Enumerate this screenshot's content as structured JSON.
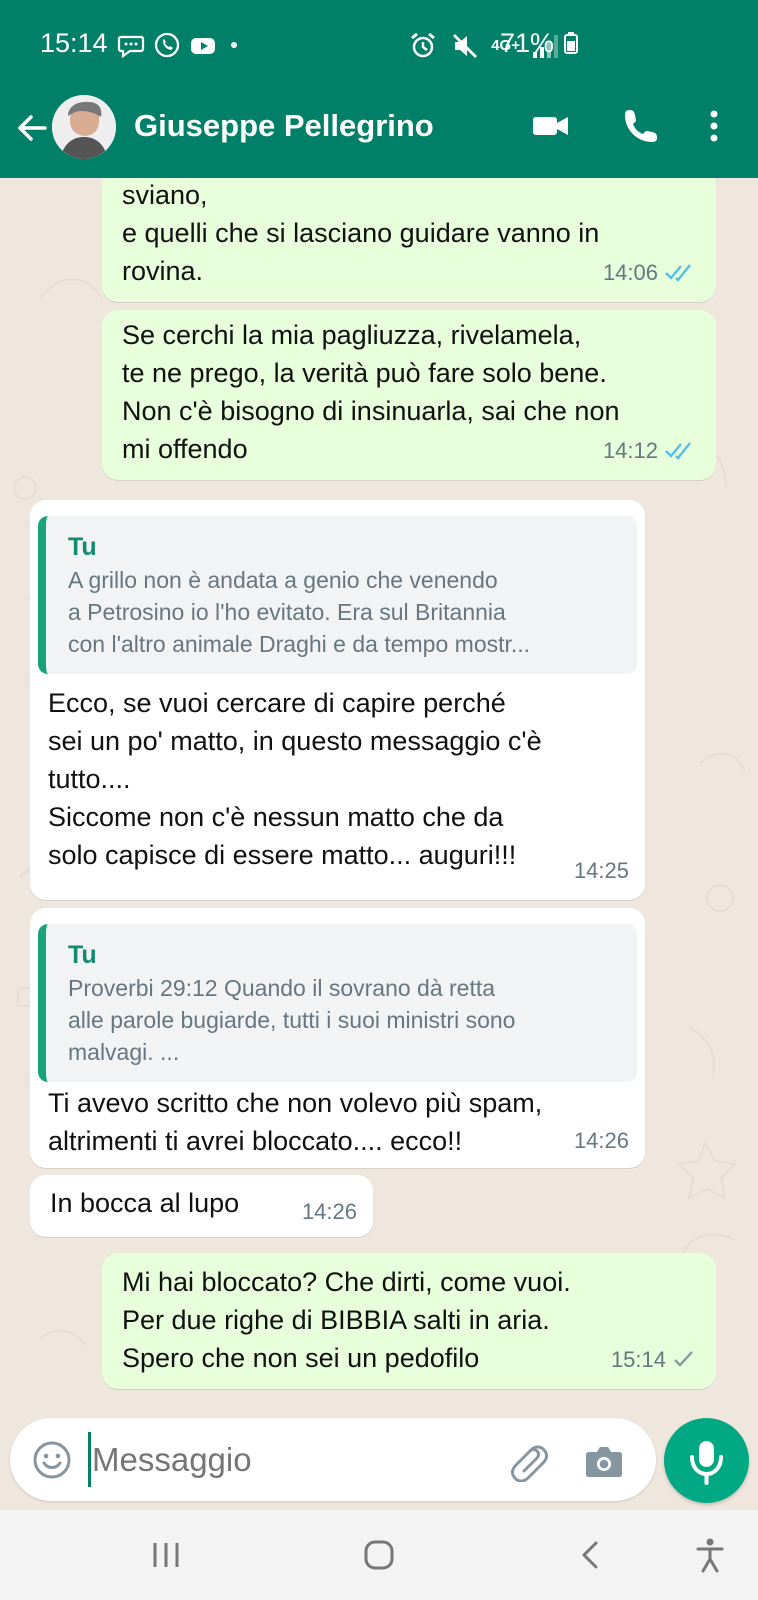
{
  "status_bar": {
    "time": "15:14",
    "network": "4G+",
    "battery": "71%"
  },
  "chat_header": {
    "contact_name": "Giuseppe Pellegrino"
  },
  "messages": [
    {
      "text": "sviano,\ne quelli che si lasciano guidare vanno in\nrovina.",
      "time": "14:06"
    },
    {
      "text": "Se cerchi la mia pagliuzza, rivelamela,\nte ne prego, la verità può fare solo bene.\nNon c'è bisogno di insinuarla, sai che non\nmi offendo",
      "time": "14:12"
    },
    {
      "quote": {
        "author": "Tu",
        "text": "A grillo non è andata a genio che venendo\na Petrosino io l'ho evitato. Era sul Britannia\ncon l'altro animale Draghi e da tempo mostr..."
      },
      "text": "Ecco, se vuoi cercare di capire perché\nsei un po' matto, in questo messaggio c'è\ntutto....\nSiccome non c'è nessun matto che da\nsolo capisce di essere matto... auguri!!!",
      "time": "14:25"
    },
    {
      "quote": {
        "author": "Tu",
        "text": "Proverbi 29:12 Quando il sovrano dà retta\nalle parole bugiarde, tutti i suoi ministri sono\nmalvagi. ..."
      },
      "text": "Ti avevo scritto che non volevo più spam,\naltrimenti ti avrei bloccato.... ecco!!",
      "time": "14:26"
    },
    {
      "text": "In bocca al lupo",
      "time": "14:26"
    },
    {
      "text": "Mi hai bloccato? Che dirti, come vuoi.\nPer due righe di BIBBIA salti in aria.\nSpero che non sei un pedofilo",
      "time": "15:14"
    }
  ],
  "composer": {
    "placeholder": "Messaggio"
  },
  "colors": {
    "header": "#008069",
    "outgoing_bubble": "#e7ffdb",
    "incoming_bubble": "#ffffff",
    "chat_background": "#efe7de",
    "read_ticks": "#53bdeb",
    "accent": "#00a884"
  },
  "icons": {
    "back": "arrow-left-icon",
    "video_call": "video-camera-icon",
    "voice_call": "phone-icon",
    "menu": "more-vertical-icon",
    "emoji": "emoji-icon",
    "attachment": "paperclip-icon",
    "camera": "camera-icon",
    "microphone": "microphone-icon"
  }
}
